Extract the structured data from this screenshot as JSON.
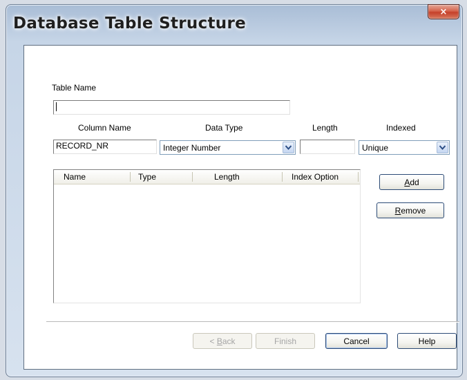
{
  "window": {
    "title": "Database Table Structure",
    "close_symbol": "×"
  },
  "form": {
    "table_name_label": "Table Name",
    "table_name_value": "",
    "column_name_label": "Column Name",
    "column_name_value": "RECORD_NR",
    "data_type_label": "Data Type",
    "data_type_value": "Integer Number",
    "length_label": "Length",
    "length_value": "",
    "indexed_label": "Indexed",
    "indexed_value": "Unique"
  },
  "columns_list": {
    "headers": [
      "Name",
      "Type",
      "Length",
      "Index Option"
    ],
    "rows": []
  },
  "side_buttons": {
    "add": {
      "mnemonic": "A",
      "rest": "dd"
    },
    "remove": {
      "mnemonic": "R",
      "rest": "emove"
    }
  },
  "footer_buttons": {
    "back": {
      "prefix": "< ",
      "mnemonic": "B",
      "rest": "ack"
    },
    "finish": "Finish",
    "cancel": "Cancel",
    "help": "Help"
  },
  "icons": {
    "close": "close-icon",
    "dropdown": "chevron-down-icon"
  }
}
